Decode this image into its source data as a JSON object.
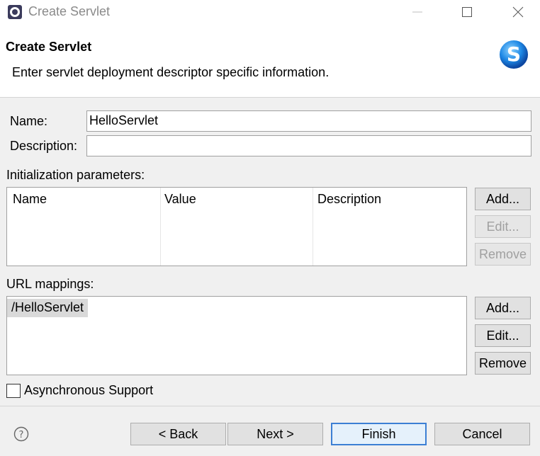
{
  "window": {
    "title": "Create Servlet"
  },
  "header": {
    "title": "Create Servlet",
    "description": "Enter servlet deployment descriptor specific information.",
    "logo_icon": "servlet-s-logo"
  },
  "form": {
    "name_label": "Name:",
    "name_value": "HelloServlet",
    "description_label": "Description:",
    "description_value": ""
  },
  "init_params": {
    "label": "Initialization parameters:",
    "columns": [
      "Name",
      "Value",
      "Description"
    ],
    "rows": [],
    "buttons": {
      "add": "Add...",
      "edit": "Edit...",
      "remove": "Remove"
    }
  },
  "url_mappings": {
    "label": "URL mappings:",
    "items": [
      "/HelloServlet"
    ],
    "buttons": {
      "add": "Add...",
      "edit": "Edit...",
      "remove": "Remove"
    }
  },
  "async_support": {
    "label": "Asynchronous Support",
    "checked": false
  },
  "footer": {
    "back": "< Back",
    "next": "Next >",
    "finish": "Finish",
    "cancel": "Cancel",
    "help_icon": "help-icon"
  },
  "colors": {
    "focus_border": "#3c7fd4",
    "logo_blue": "#1e88e5"
  }
}
